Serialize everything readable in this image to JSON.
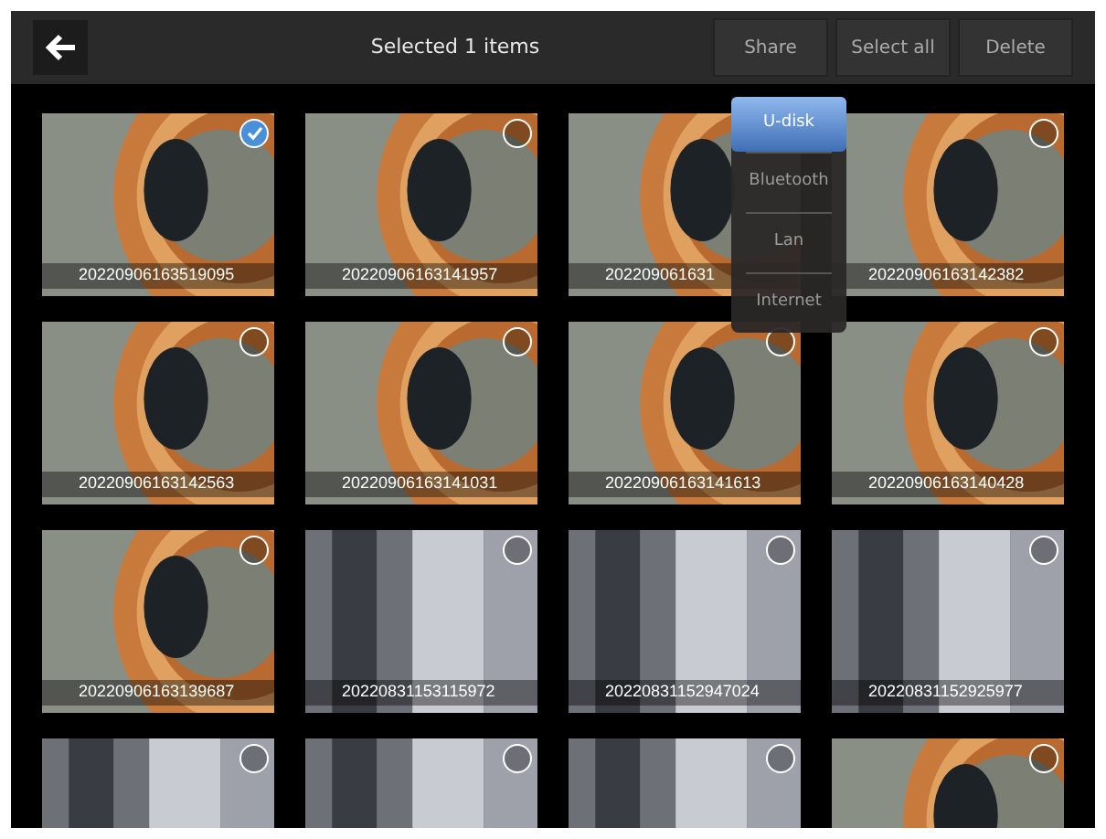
{
  "header": {
    "title": "Selected 1 items",
    "buttons": [
      "Share",
      "Select all",
      "Delete"
    ]
  },
  "share_menu": [
    {
      "label": "U-disk",
      "selected": true
    },
    {
      "label": "Bluetooth",
      "selected": false
    },
    {
      "label": "Lan",
      "selected": false
    },
    {
      "label": "Internet",
      "selected": false
    }
  ],
  "files": [
    {
      "name": "20220906163519095",
      "kind": "pipe",
      "checked": true
    },
    {
      "name": "20220906163141957",
      "kind": "pipe",
      "checked": false
    },
    {
      "name": "202209061631",
      "kind": "pipe"
    },
    {
      "name": "20220906163142382",
      "kind": "pipe",
      "checked": false
    },
    {
      "name": "20220906163142563",
      "kind": "pipe",
      "checked": false
    },
    {
      "name": "20220906163141031",
      "kind": "pipe",
      "checked": false
    },
    {
      "name": "20220906163141613",
      "kind": "pipe",
      "checked": false
    },
    {
      "name": "20220906163140428",
      "kind": "pipe",
      "checked": false
    },
    {
      "name": "20220906163139687",
      "kind": "pipe",
      "checked": false
    },
    {
      "name": "20220831153115972",
      "kind": "wall",
      "checked": false
    },
    {
      "name": "20220831152947024",
      "kind": "wall",
      "checked": false
    },
    {
      "name": "20220831152925977",
      "kind": "wall",
      "checked": false
    },
    {
      "kind": "wall",
      "checked": false
    },
    {
      "kind": "wall",
      "checked": false
    },
    {
      "kind": "wall",
      "checked": false
    },
    {
      "kind": "pipe",
      "checked": false
    }
  ]
}
